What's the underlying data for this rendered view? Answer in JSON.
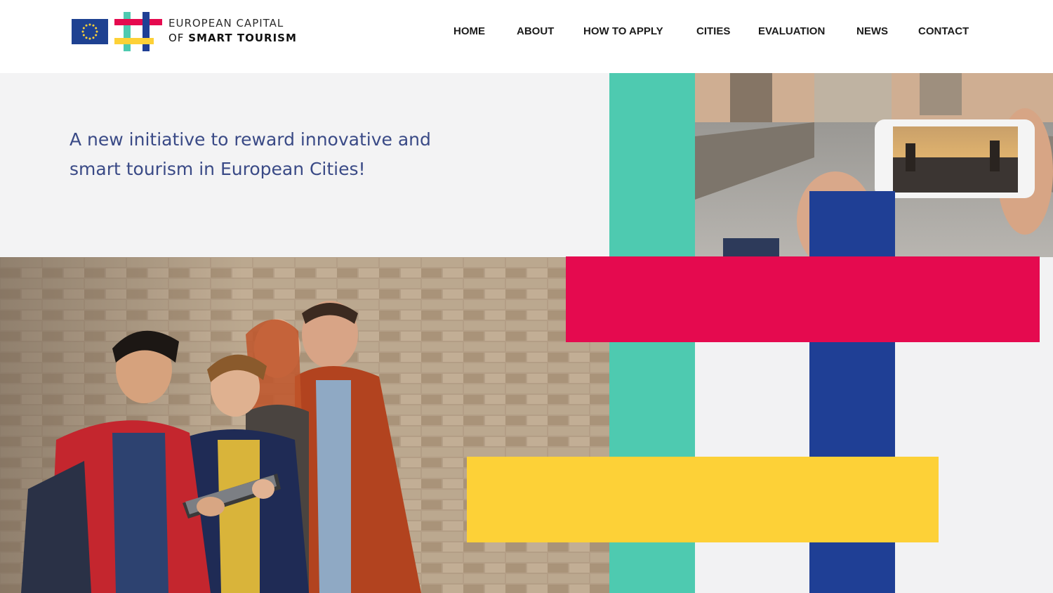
{
  "header": {
    "logo": {
      "line1": "EUROPEAN CAPITAL",
      "line2_prefix": "OF",
      "line2_strong": "SMART TOURISM"
    },
    "nav": [
      {
        "label": "HOME"
      },
      {
        "label": "ABOUT"
      },
      {
        "label": "HOW TO APPLY"
      },
      {
        "label": "CITIES"
      },
      {
        "label": "EVALUATION"
      },
      {
        "label": "NEWS"
      },
      {
        "label": "CONTACT"
      }
    ]
  },
  "hero": {
    "tagline": "A new initiative to reward innovative and smart tourism in European Cities!"
  },
  "colors": {
    "teal": "#4ecab0",
    "red": "#e50a4f",
    "blue": "#1f3f95",
    "yellow": "#fdd137",
    "tagline": "#3a4a86",
    "eu_flag": "#1e4191"
  },
  "images": {
    "group_photo": "group-of-tourists-with-tablet-photo",
    "bridge_photo": "smartphone-photographing-bridge-photo"
  }
}
